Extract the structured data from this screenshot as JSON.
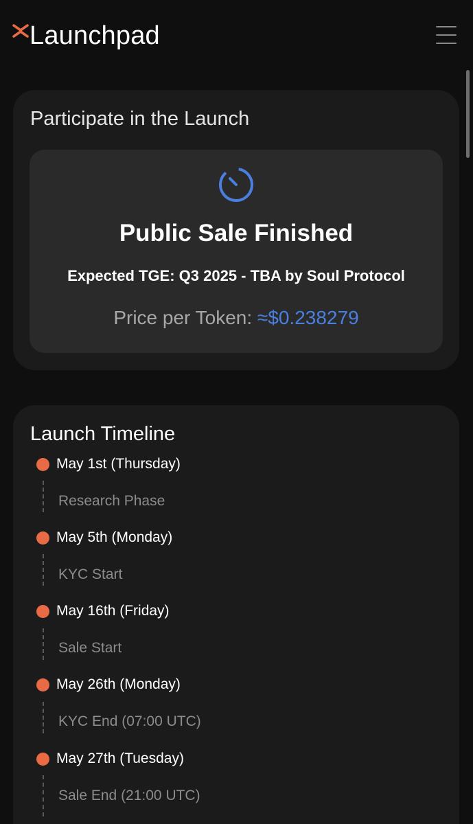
{
  "header": {
    "logo_text": "Launchpad",
    "logo_icon": "x-mark-icon",
    "menu_icon": "hamburger-menu-icon"
  },
  "colors": {
    "background": "#0f0f0f",
    "card": "#1b1b1b",
    "inner_box": "#2a2a2a",
    "accent_orange": "#e86b45",
    "accent_blue": "#4a7fe0"
  },
  "participate": {
    "title": "Participate in the Launch",
    "status_icon": "timer-icon",
    "status": "Public Sale Finished",
    "tge": "Expected TGE: Q3 2025 - TBA by Soul Protocol",
    "price_label": "Price per Token: ",
    "price_value": "≈$0.238279"
  },
  "timeline": {
    "title": "Launch Timeline",
    "items": [
      {
        "date": "May 1st (Thursday)",
        "event": "Research Phase"
      },
      {
        "date": "May 5th (Monday)",
        "event": "KYC Start"
      },
      {
        "date": "May 16th (Friday)",
        "event": "Sale Start"
      },
      {
        "date": "May 26th (Monday)",
        "event": "KYC End (07:00 UTC)"
      },
      {
        "date": "May 27th (Tuesday)",
        "event": "Sale End (21:00 UTC)"
      }
    ]
  }
}
